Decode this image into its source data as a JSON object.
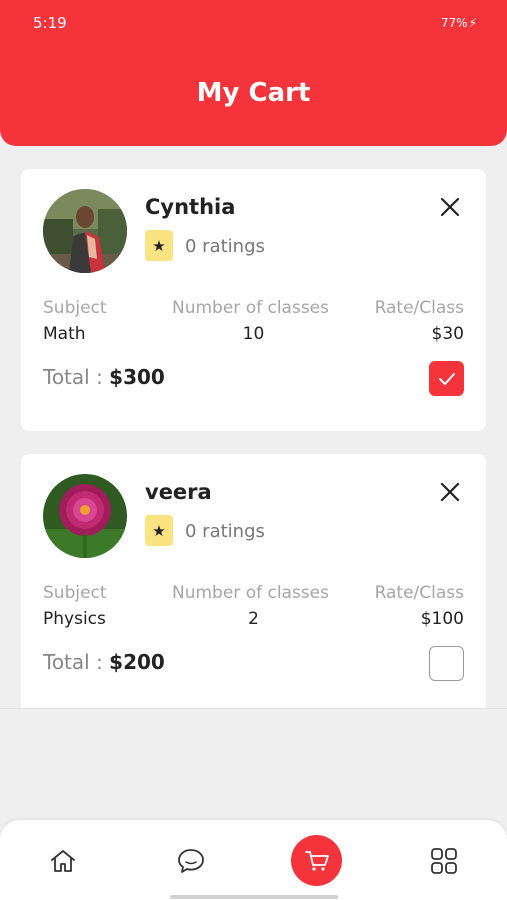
{
  "status_bar": {
    "time": "5:19",
    "battery": "77%"
  },
  "header": {
    "title": "My Cart"
  },
  "columns": {
    "subject": "Subject",
    "classes": "Number of classes",
    "rate": "Rate/Class"
  },
  "total_label": "Total : ",
  "cart_items": [
    {
      "tutor": "Cynthia",
      "ratings": "0 ratings",
      "subject": "Math",
      "classes": "10",
      "rate": "$30",
      "total": "$300",
      "selected": true
    },
    {
      "tutor": "veera",
      "ratings": "0 ratings",
      "subject": "Physics",
      "classes": "2",
      "rate": "$100",
      "total": "$200",
      "selected": false
    }
  ],
  "bottom_nav": [
    "home-icon",
    "chat-icon",
    "cart-icon",
    "grid-menu-icon"
  ],
  "colors": {
    "accent": "#f5333a",
    "star_badge": "#fae380",
    "background": "#efefef"
  }
}
